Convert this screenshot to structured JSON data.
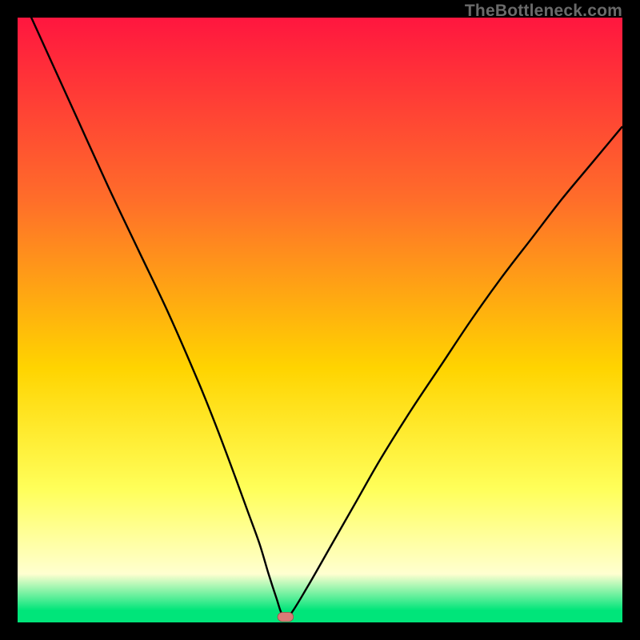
{
  "watermark": "TheBottleneck.com",
  "colors": {
    "bg": "#000000",
    "grad_top": "#ff163f",
    "grad_mid_top": "#ff6d2a",
    "grad_mid": "#ffd400",
    "grad_mid_bot": "#ffff5a",
    "grad_near_bot": "#ffffd0",
    "grad_bottom": "#00e57a",
    "curve": "#000000",
    "marker_fill": "#da7b77",
    "marker_stroke": "#9c4c49"
  },
  "chart_data": {
    "type": "line",
    "title": "",
    "xlabel": "",
    "ylabel": "",
    "xlim": [
      0,
      100
    ],
    "ylim": [
      0,
      100
    ],
    "note": "Axes are implicit (no ticks/labels shown). Values are percentage readings off the plot area.",
    "series": [
      {
        "name": "bottleneck-curve",
        "x": [
          0,
          5,
          10,
          15,
          20,
          25,
          30,
          33,
          36,
          38,
          40,
          41.5,
          42.8,
          43.8,
          45,
          48,
          52,
          56,
          60,
          65,
          70,
          75,
          80,
          85,
          90,
          95,
          100
        ],
        "values": [
          105,
          94,
          83,
          72,
          61.5,
          51,
          39.5,
          32,
          24,
          18.5,
          13,
          8,
          4,
          1.2,
          1.2,
          6,
          13,
          20,
          27,
          35,
          42.5,
          50,
          57,
          63.5,
          70,
          76,
          82
        ]
      }
    ],
    "markers": [
      {
        "name": "optimal-point",
        "x": 44.3,
        "y": 0.9
      }
    ],
    "background_gradient_stops": [
      {
        "pct": 0,
        "color": "#ff163f"
      },
      {
        "pct": 30,
        "color": "#ff6d2a"
      },
      {
        "pct": 58,
        "color": "#ffd400"
      },
      {
        "pct": 78,
        "color": "#ffff5a"
      },
      {
        "pct": 92,
        "color": "#ffffd0"
      },
      {
        "pct": 98,
        "color": "#00e57a"
      },
      {
        "pct": 100,
        "color": "#00e57a"
      }
    ]
  }
}
